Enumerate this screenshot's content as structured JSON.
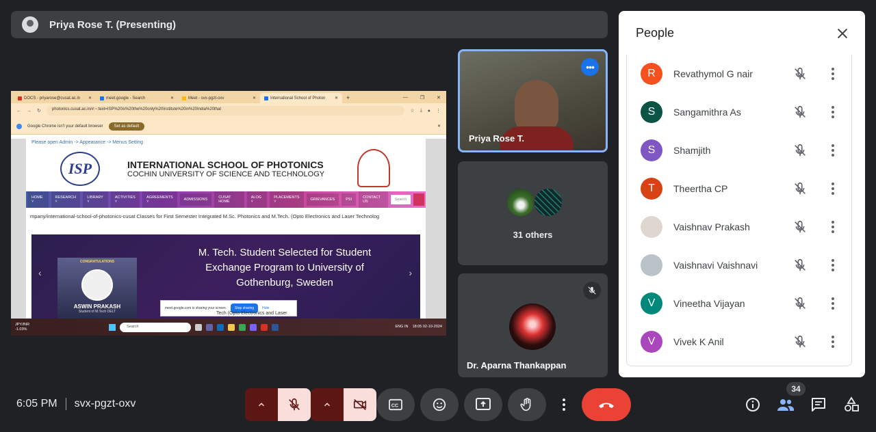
{
  "presenter": {
    "name": "Priya Rose T. (Presenting)"
  },
  "shared_screen": {
    "tabs": [
      {
        "label": "DOCS - priyarose@cusat.ac.in",
        "color": "#d93025"
      },
      {
        "label": "meet.google - Search",
        "color": "#1a73e8"
      },
      {
        "label": "Meet - svx-pgzt-oxv",
        "color": "#fbbc04"
      },
      {
        "label": "International School of Photon",
        "color": "#1a73e8"
      }
    ],
    "address": "photonics.cusat.ac.in/#:~:text=ISP%20is%20the%20only%20Institute%20in%20India%20that",
    "info_bar": {
      "message": "Google Chrome isn't your default browser",
      "button": "Set as default"
    },
    "admin_note": "Please open Admin -> Appearance -> Menus Setting",
    "site": {
      "logo": "ISP",
      "title": "INTERNATIONAL SCHOOL OF PHOTONICS",
      "subtitle": "COCHIN UNIVERSITY OF SCIENCE AND TECHNOLOGY",
      "nav": [
        "HOME ˅",
        "RESEARCH ˅",
        "LIBRARY ˅",
        "ACTIVITIES ˅",
        "AGREEMENTS ˅",
        "ADMISSIONS",
        "CUSAT HOME",
        "ALOG ˅",
        "PLACEMENTS ˅",
        "GRIEVANCES",
        "PSI",
        "CONTACT US"
      ],
      "search_placeholder": "Search",
      "marquee": "mpany/international-school-of-photonics-cusat   Classes for First Semester Integrated M.Sc. Photonics and M.Tech. (Opto Electronics and Laser Technolog",
      "banner": {
        "headline": "M. Tech. Student Selected for Student Exchange Program to University of Gothenburg, Sweden",
        "congrats": "CONGRATULATIONS",
        "student_name": "ASWIN PRAKASH",
        "student_sub": "Student of M.Tech OELT"
      },
      "overflow_caption": "Tech (Opto Electronics and Laser"
    },
    "sharing_bar": {
      "message": "meet.google.com is sharing your screen.",
      "stop": "Stop sharing",
      "hide": "Hide"
    },
    "taskbar": {
      "stock_line1": "JPY/INR",
      "stock_line2": "-1.03%",
      "search": "Search",
      "lang_line1": "ENG",
      "lang_line2": "IN",
      "clock_time": "18:05",
      "clock_date": "02-10-2024"
    }
  },
  "tiles": {
    "presenter_tile": {
      "name": "Priya Rose T."
    },
    "others_tile": {
      "label": "31 others"
    },
    "aparna_tile": {
      "name": "Dr. Aparna Thankappan"
    }
  },
  "people_panel": {
    "title": "People",
    "participants": [
      {
        "name": "Revathymol G nair",
        "initial": "R",
        "color": "#f4511e"
      },
      {
        "name": "Sangamithra As",
        "initial": "S",
        "color": "#0b5345"
      },
      {
        "name": "Shamjith",
        "initial": "S",
        "color": "#7e57c2"
      },
      {
        "name": "Theertha CP",
        "initial": "T",
        "color": "#d84315"
      },
      {
        "name": "Vaishnav Prakash",
        "initial": "",
        "color": "#e0d6d0"
      },
      {
        "name": "Vaishnavi Vaishnavi",
        "initial": "",
        "color": "#b8c2c8"
      },
      {
        "name": "Vineetha Vijayan",
        "initial": "V",
        "color": "#00897b"
      },
      {
        "name": "Vivek K Anil",
        "initial": "V",
        "color": "#ab47bc"
      }
    ]
  },
  "footer": {
    "time": "6:05 PM",
    "meeting_code": "svx-pgzt-oxv",
    "people_count": "34"
  }
}
